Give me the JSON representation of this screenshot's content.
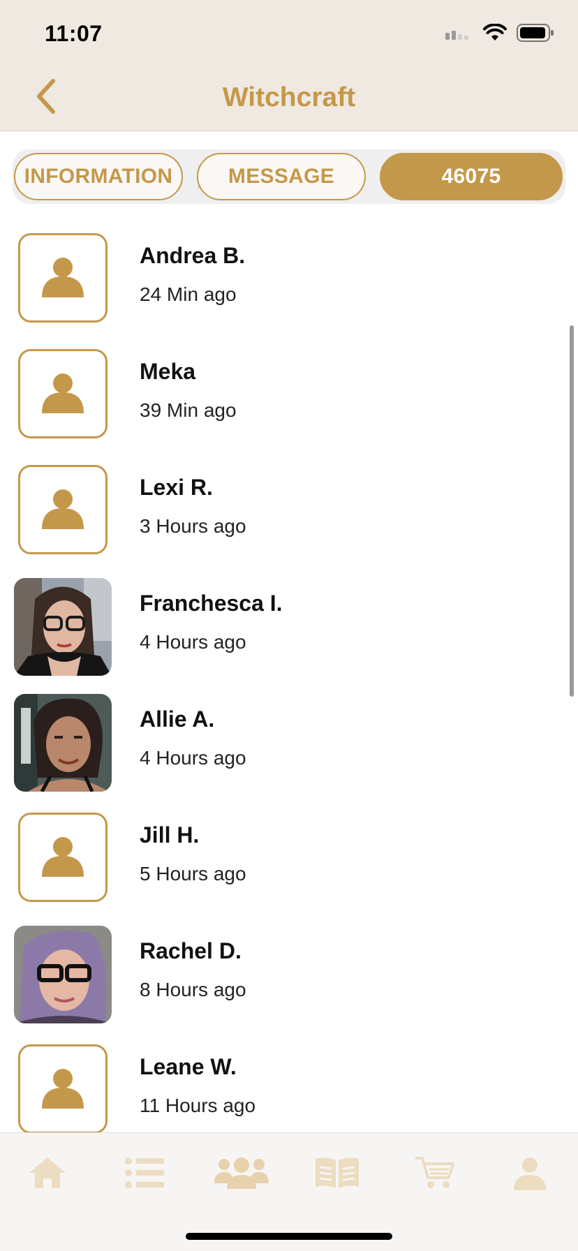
{
  "status_bar": {
    "time": "11:07",
    "icons": [
      "cellular-signal-icon",
      "wifi-icon",
      "battery-icon"
    ]
  },
  "nav": {
    "title": "Witchcraft",
    "back_icon": "chevron-left-icon"
  },
  "segments": {
    "information": "INFORMATION",
    "message": "MESSAGE",
    "members_count": "46075",
    "active": "members_count"
  },
  "members": [
    {
      "name": "Andrea B.",
      "time": "24 Min ago",
      "avatar": "placeholder"
    },
    {
      "name": "Meka",
      "time": "39 Min ago",
      "avatar": "placeholder"
    },
    {
      "name": "Lexi R.",
      "time": "3 Hours ago",
      "avatar": "placeholder"
    },
    {
      "name": "Franchesca I.",
      "time": "4 Hours ago",
      "avatar": "photo"
    },
    {
      "name": "Allie A.",
      "time": "4 Hours ago",
      "avatar": "photo"
    },
    {
      "name": "Jill H.",
      "time": "5 Hours ago",
      "avatar": "placeholder"
    },
    {
      "name": "Rachel D.",
      "time": "8 Hours ago",
      "avatar": "photo"
    },
    {
      "name": "Leane W.",
      "time": "11 Hours ago",
      "avatar": "placeholder"
    }
  ],
  "tab_bar": {
    "tabs": [
      "home-icon",
      "list-icon",
      "groups-icon",
      "book-icon",
      "cart-icon",
      "profile-icon"
    ],
    "active": "groups-icon"
  },
  "colors": {
    "accent": "#c4984a",
    "header_bg": "#efe9e1",
    "tab_icon_inactive": "#ecdcc0",
    "tab_icon_active": "#e8d1ad"
  }
}
